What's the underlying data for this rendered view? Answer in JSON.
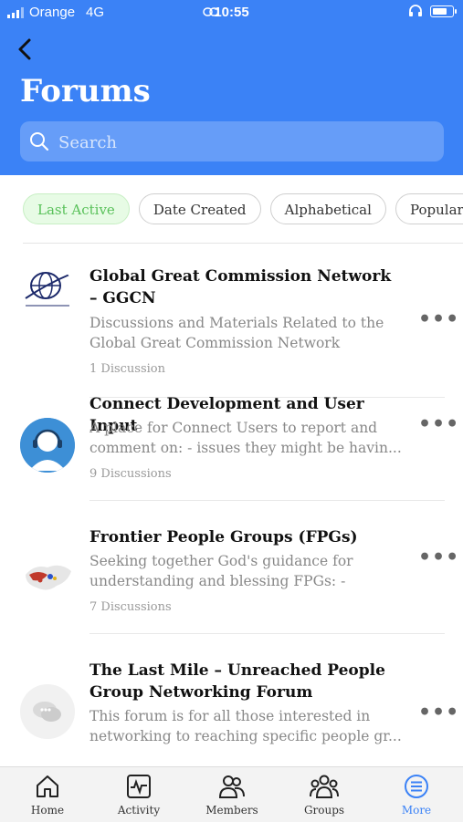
{
  "status": {
    "carrier": "Orange",
    "network": "4G",
    "time": "10:55"
  },
  "header": {
    "title": "Forums",
    "search_placeholder": "Search"
  },
  "filters": [
    {
      "label": "Last Active",
      "active": true
    },
    {
      "label": "Date Created",
      "active": false
    },
    {
      "label": "Alphabetical",
      "active": false
    },
    {
      "label": "Popularity",
      "active": false
    }
  ],
  "forums": [
    {
      "title": "Global Great Commission Network – GGCN",
      "description": "Discussions and Materials Related to the Global Great Commission Network",
      "count": "1 Discussion",
      "icon": "globe-logo"
    },
    {
      "title": "Connect Development and User Input",
      "description": "A place for Connect Users to report and comment on: - issues they might be havin...",
      "count": "9 Discussions",
      "icon": "support-agent-avatar"
    },
    {
      "title": "Frontier People Groups (FPGs)",
      "description": "Seeking together God's guidance for understanding and blessing FPGs: - These...",
      "count": "7 Discussions",
      "icon": "world-map-logo"
    },
    {
      "title": "The Last Mile – Unreached People Group Networking Forum",
      "description": "This forum is for all those interested in networking to reaching specific people gr...",
      "count": "",
      "icon": "chat-bubbles-avatar"
    }
  ],
  "tabbar": [
    {
      "label": "Home",
      "icon": "home-icon"
    },
    {
      "label": "Activity",
      "icon": "activity-icon"
    },
    {
      "label": "Members",
      "icon": "members-icon"
    },
    {
      "label": "Groups",
      "icon": "groups-icon"
    },
    {
      "label": "More",
      "icon": "more-icon",
      "active": true
    }
  ],
  "colors": {
    "accent": "#3b82f6",
    "chip_active_bg": "#e7fbe5",
    "chip_active_text": "#59c15a"
  }
}
